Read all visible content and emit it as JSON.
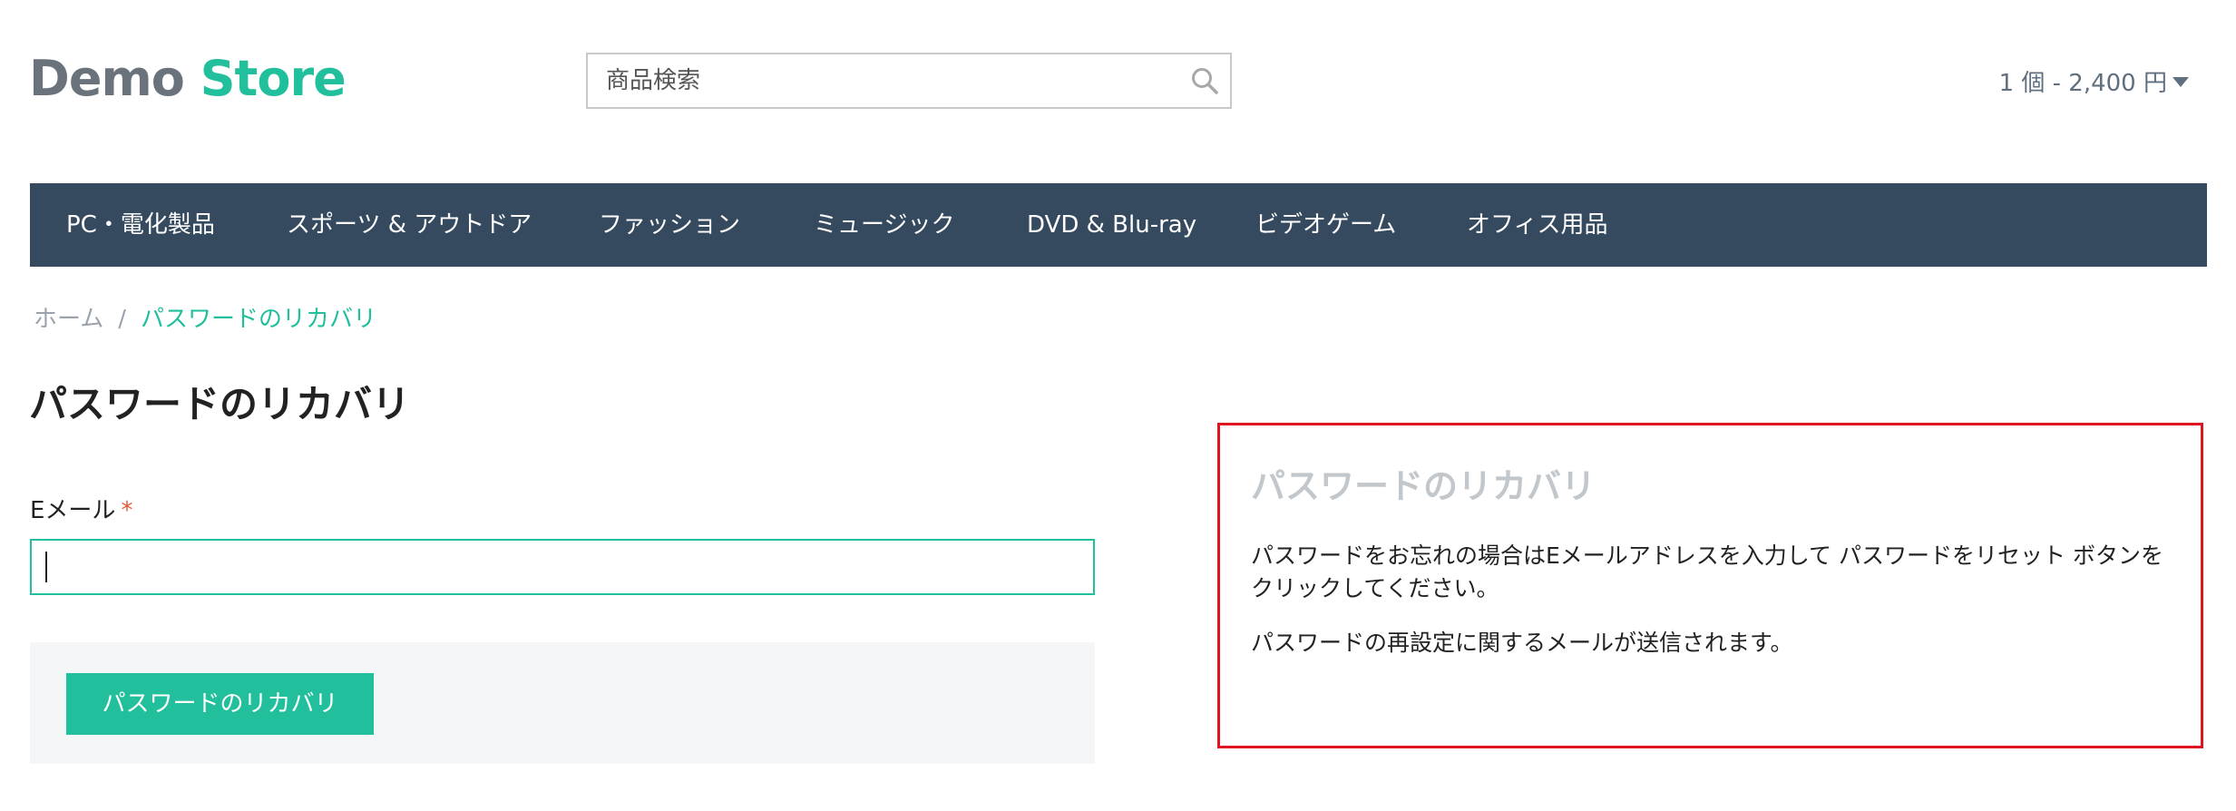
{
  "header": {
    "logo_part1": "Demo",
    "logo_part2": "Store",
    "search_placeholder": "商品検索",
    "search_icon": "search-icon",
    "cart_summary": "1 個 - 2,400 円",
    "cart_icon": "caret-down-icon"
  },
  "nav": {
    "items": [
      {
        "label": "PC・電化製品"
      },
      {
        "label": "スポーツ & アウトドア"
      },
      {
        "label": "ファッション"
      },
      {
        "label": "ミュージック"
      },
      {
        "label": "DVD & Blu-ray"
      },
      {
        "label": "ビデオゲーム"
      },
      {
        "label": "オフィス用品"
      }
    ]
  },
  "breadcrumb": {
    "home": "ホーム",
    "separator": "/",
    "current": "パスワードのリカバリ"
  },
  "form": {
    "title": "パスワードのリカバリ",
    "email_label": "Eメール",
    "required_mark": "*",
    "email_value": "",
    "submit_label": "パスワードのリカバリ"
  },
  "info": {
    "title": "パスワードのリカバリ",
    "paragraph1": "パスワードをお忘れの場合はEメールアドレスを入力して パスワードをリセット ボタンをクリックしてください。",
    "paragraph2": "パスワードの再設定に関するメールが送信されます。"
  },
  "colors": {
    "accent": "#21bf9b",
    "nav_background": "#354a5f",
    "highlight_border": "#e0141e",
    "logo_gray": "#6a737c"
  }
}
